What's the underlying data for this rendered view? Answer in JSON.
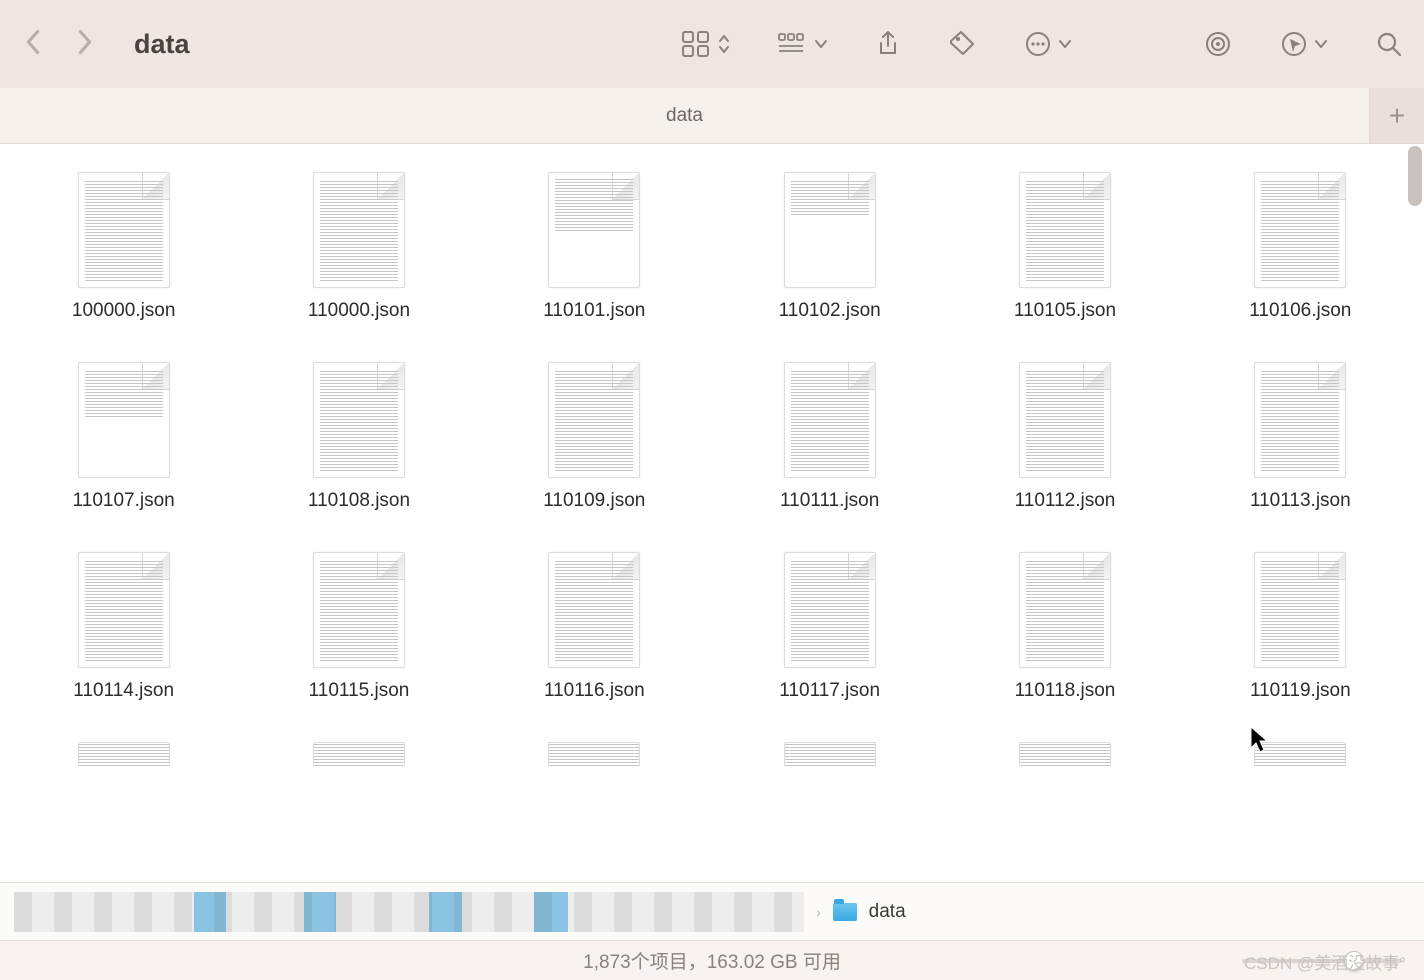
{
  "toolbar": {
    "title": "data"
  },
  "tab": {
    "label": "data"
  },
  "files": [
    {
      "name": "100000.json",
      "fill": "full"
    },
    {
      "name": "110000.json",
      "fill": "full"
    },
    {
      "name": "110101.json",
      "fill": "partial-a"
    },
    {
      "name": "110102.json",
      "fill": "partial-b"
    },
    {
      "name": "110105.json",
      "fill": "full"
    },
    {
      "name": "110106.json",
      "fill": "full"
    },
    {
      "name": "110107.json",
      "fill": "partial-c"
    },
    {
      "name": "110108.json",
      "fill": "full"
    },
    {
      "name": "110109.json",
      "fill": "full"
    },
    {
      "name": "110111.json",
      "fill": "full"
    },
    {
      "name": "110112.json",
      "fill": "full"
    },
    {
      "name": "110113.json",
      "fill": "full"
    },
    {
      "name": "110114.json",
      "fill": "full"
    },
    {
      "name": "110115.json",
      "fill": "full"
    },
    {
      "name": "110116.json",
      "fill": "full"
    },
    {
      "name": "110117.json",
      "fill": "full"
    },
    {
      "name": "110118.json",
      "fill": "full"
    },
    {
      "name": "110119.json",
      "fill": "full"
    }
  ],
  "pathbar": {
    "folder": "data"
  },
  "status": {
    "item_count": "1,873",
    "items_word": "个项目",
    "sep": "，",
    "free_space": "163.02 GB",
    "free_word": "可用"
  },
  "watermark": "CSDN @美酒没故事°"
}
